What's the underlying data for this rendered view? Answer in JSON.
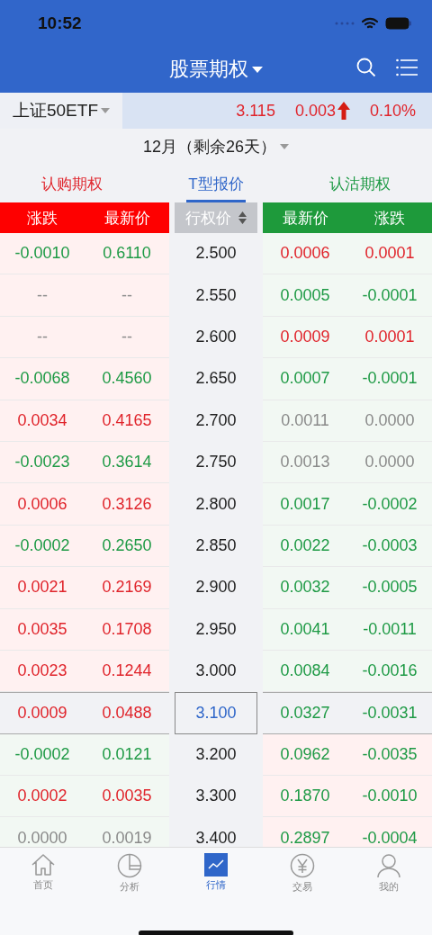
{
  "status_bar": {
    "time": "10:52"
  },
  "header": {
    "title": "股票期权"
  },
  "underlying": {
    "name": "上证50ETF",
    "price": "3.115",
    "change": "0.003",
    "rising": true,
    "percent": "0.10%"
  },
  "expiry": {
    "label": "12月（剩余26天）"
  },
  "tabs": [
    {
      "label": "认购期权",
      "selected": false,
      "color": "#e0262d"
    },
    {
      "label": "T型报价",
      "selected": true,
      "color": "#2f66c9"
    },
    {
      "label": "认沽期权",
      "selected": false,
      "color": "#1e9a45"
    }
  ],
  "column_headers": {
    "call": [
      "涨跌",
      "最新价"
    ],
    "strike": "行权价",
    "put": [
      "最新价",
      "涨跌"
    ]
  },
  "rows": [
    {
      "strike": "2.500",
      "selected": false,
      "call_in_money": true,
      "call": [
        {
          "text": "-0.0010",
          "kind": "down"
        },
        {
          "text": "0.6110",
          "kind": "down"
        }
      ],
      "put": [
        {
          "text": "0.0006",
          "kind": "up"
        },
        {
          "text": "0.0001",
          "kind": "up"
        }
      ]
    },
    {
      "strike": "2.550",
      "selected": false,
      "call_in_money": true,
      "call": [
        {
          "text": "--",
          "kind": "flat"
        },
        {
          "text": "--",
          "kind": "flat"
        }
      ],
      "put": [
        {
          "text": "0.0005",
          "kind": "down"
        },
        {
          "text": "-0.0001",
          "kind": "down"
        }
      ]
    },
    {
      "strike": "2.600",
      "selected": false,
      "call_in_money": true,
      "call": [
        {
          "text": "--",
          "kind": "flat"
        },
        {
          "text": "--",
          "kind": "flat"
        }
      ],
      "put": [
        {
          "text": "0.0009",
          "kind": "up"
        },
        {
          "text": "0.0001",
          "kind": "up"
        }
      ]
    },
    {
      "strike": "2.650",
      "selected": false,
      "call_in_money": true,
      "call": [
        {
          "text": "-0.0068",
          "kind": "down"
        },
        {
          "text": "0.4560",
          "kind": "down"
        }
      ],
      "put": [
        {
          "text": "0.0007",
          "kind": "down"
        },
        {
          "text": "-0.0001",
          "kind": "down"
        }
      ]
    },
    {
      "strike": "2.700",
      "selected": false,
      "call_in_money": true,
      "call": [
        {
          "text": "0.0034",
          "kind": "up"
        },
        {
          "text": "0.4165",
          "kind": "up"
        }
      ],
      "put": [
        {
          "text": "0.0011",
          "kind": "flat"
        },
        {
          "text": "0.0000",
          "kind": "flat"
        }
      ]
    },
    {
      "strike": "2.750",
      "selected": false,
      "call_in_money": true,
      "call": [
        {
          "text": "-0.0023",
          "kind": "down"
        },
        {
          "text": "0.3614",
          "kind": "down"
        }
      ],
      "put": [
        {
          "text": "0.0013",
          "kind": "flat"
        },
        {
          "text": "0.0000",
          "kind": "flat"
        }
      ]
    },
    {
      "strike": "2.800",
      "selected": false,
      "call_in_money": true,
      "call": [
        {
          "text": "0.0006",
          "kind": "up"
        },
        {
          "text": "0.3126",
          "kind": "up"
        }
      ],
      "put": [
        {
          "text": "0.0017",
          "kind": "down"
        },
        {
          "text": "-0.0002",
          "kind": "down"
        }
      ]
    },
    {
      "strike": "2.850",
      "selected": false,
      "call_in_money": true,
      "call": [
        {
          "text": "-0.0002",
          "kind": "down"
        },
        {
          "text": "0.2650",
          "kind": "down"
        }
      ],
      "put": [
        {
          "text": "0.0022",
          "kind": "down"
        },
        {
          "text": "-0.0003",
          "kind": "down"
        }
      ]
    },
    {
      "strike": "2.900",
      "selected": false,
      "call_in_money": true,
      "call": [
        {
          "text": "0.0021",
          "kind": "up"
        },
        {
          "text": "0.2169",
          "kind": "up"
        }
      ],
      "put": [
        {
          "text": "0.0032",
          "kind": "down"
        },
        {
          "text": "-0.0005",
          "kind": "down"
        }
      ]
    },
    {
      "strike": "2.950",
      "selected": false,
      "call_in_money": true,
      "call": [
        {
          "text": "0.0035",
          "kind": "up"
        },
        {
          "text": "0.1708",
          "kind": "up"
        }
      ],
      "put": [
        {
          "text": "0.0041",
          "kind": "down"
        },
        {
          "text": "-0.0011",
          "kind": "down"
        }
      ]
    },
    {
      "strike": "3.000",
      "selected": false,
      "call_in_money": true,
      "call": [
        {
          "text": "0.0023",
          "kind": "up"
        },
        {
          "text": "0.1244",
          "kind": "up"
        }
      ],
      "put": [
        {
          "text": "0.0084",
          "kind": "down"
        },
        {
          "text": "-0.0016",
          "kind": "down"
        }
      ]
    },
    {
      "strike": "3.100",
      "selected": true,
      "call": [
        {
          "text": "0.0009",
          "kind": "up"
        },
        {
          "text": "0.0488",
          "kind": "up"
        }
      ],
      "put": [
        {
          "text": "0.0327",
          "kind": "down"
        },
        {
          "text": "-0.0031",
          "kind": "down"
        }
      ]
    },
    {
      "strike": "3.200",
      "selected": false,
      "call_in_money": false,
      "call": [
        {
          "text": "-0.0002",
          "kind": "down"
        },
        {
          "text": "0.0121",
          "kind": "down"
        }
      ],
      "put": [
        {
          "text": "0.0962",
          "kind": "down"
        },
        {
          "text": "-0.0035",
          "kind": "down"
        }
      ]
    },
    {
      "strike": "3.300",
      "selected": false,
      "call_in_money": false,
      "call": [
        {
          "text": "0.0002",
          "kind": "up"
        },
        {
          "text": "0.0035",
          "kind": "up"
        }
      ],
      "put": [
        {
          "text": "0.1870",
          "kind": "down"
        },
        {
          "text": "-0.0010",
          "kind": "down"
        }
      ]
    },
    {
      "strike": "3.400",
      "selected": false,
      "call_in_money": false,
      "call": [
        {
          "text": "0.0000",
          "kind": "flat"
        },
        {
          "text": "0.0019",
          "kind": "flat"
        }
      ],
      "put": [
        {
          "text": "0.2897",
          "kind": "down"
        },
        {
          "text": "-0.0004",
          "kind": "down"
        }
      ]
    }
  ],
  "nav": [
    {
      "label": "首页",
      "kind": "home",
      "selected": false
    },
    {
      "label": "分析",
      "kind": "pie",
      "selected": false
    },
    {
      "label": "行情",
      "kind": "chart",
      "selected": true
    },
    {
      "label": "交易",
      "kind": "yen",
      "selected": false
    },
    {
      "label": "我的",
      "kind": "person",
      "selected": false
    }
  ]
}
